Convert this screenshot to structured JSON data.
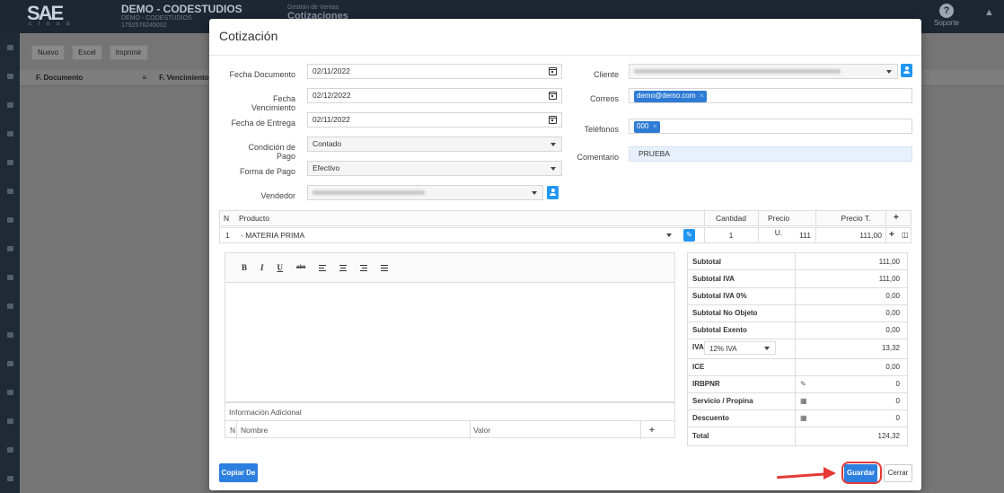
{
  "app": {
    "logo": "SAE",
    "logo_sub": "c l o u d",
    "company_name": "DEMO - CODESTUDIOS",
    "company_sub1": "DEMO - CODESTUDIOS",
    "company_sub2": "1792576245002",
    "module_caption": "Gestión de Ventas",
    "module_title": "Cotizaciones",
    "support_label": "Soporte"
  },
  "background": {
    "toolbar": [
      "Nuevo",
      "Excel",
      "Imprimir"
    ],
    "col_fdoc": "F. Documento",
    "col_fvenc": "F. Vencimiento"
  },
  "modal": {
    "title": "Cotización",
    "form": {
      "fecha_documento_label": "Fecha Documento",
      "fecha_documento": "02/11/2022",
      "fecha_vencimiento_label": "Fecha Vencimiento",
      "fecha_vencimiento": "02/12/2022",
      "fecha_entrega_label": "Fecha de Entrega",
      "fecha_entrega": "02/11/2022",
      "condicion_label": "Condición de Pago",
      "condicion": "Contado",
      "forma_label": "Forma de Pago",
      "forma": "Efectivo",
      "vendedor_label": "Vendedor",
      "cliente_label": "Cliente",
      "correos_label": "Correos",
      "correo_tag": "demo@demo.com",
      "telefonos_label": "Teléfonos",
      "telefono_tag": "000",
      "comentario_label": "Comentario",
      "comentario": "PRUEBA"
    },
    "products": {
      "headers": {
        "n": "N",
        "producto": "Producto",
        "cantidad": "Cantidad",
        "precio_u": "Precio U.",
        "precio_t": "Precio T.",
        "add": "+"
      },
      "rows": [
        {
          "n": "1",
          "producto": "- MATERIA PRIMA",
          "cantidad": "1",
          "precio_u": "111",
          "precio_t": "111,00"
        }
      ]
    },
    "editor_tools": [
      "B",
      "I",
      "U",
      "abc"
    ],
    "info": {
      "title": "Información Adicional",
      "col_n": "N",
      "col_nombre": "Nombre",
      "col_valor": "Valor",
      "add": "+"
    },
    "totals": {
      "subtotal_label": "Subtotal",
      "subtotal": "111,00",
      "subtotal_iva_label": "Subtotal IVA",
      "subtotal_iva": "111,00",
      "subtotal_iva0_label": "Subtotal IVA 0%",
      "subtotal_iva0": "0,00",
      "subtotal_no_objeto_label": "Subtotal No Objeto",
      "subtotal_no_objeto": "0,00",
      "subtotal_exento_label": "Subtotal Exento",
      "subtotal_exento": "0,00",
      "iva_label": "IVA",
      "iva_select": "12% IVA",
      "iva": "13,32",
      "ice_label": "ICE",
      "ice": "0,00",
      "irbpnr_label": "IRBPNR",
      "irbpnr": "0",
      "servicio_label": "Servicio / Propina",
      "servicio": "0",
      "descuento_label": "Descuento",
      "descuento": "0",
      "total_label": "Total",
      "total": "124,32"
    },
    "buttons": {
      "copiar": "Copiar De",
      "guardar": "Guardar",
      "cerrar": "Cerrar"
    }
  },
  "colors": {
    "accent": "#2d7fe0",
    "highlight": "#e53935"
  }
}
